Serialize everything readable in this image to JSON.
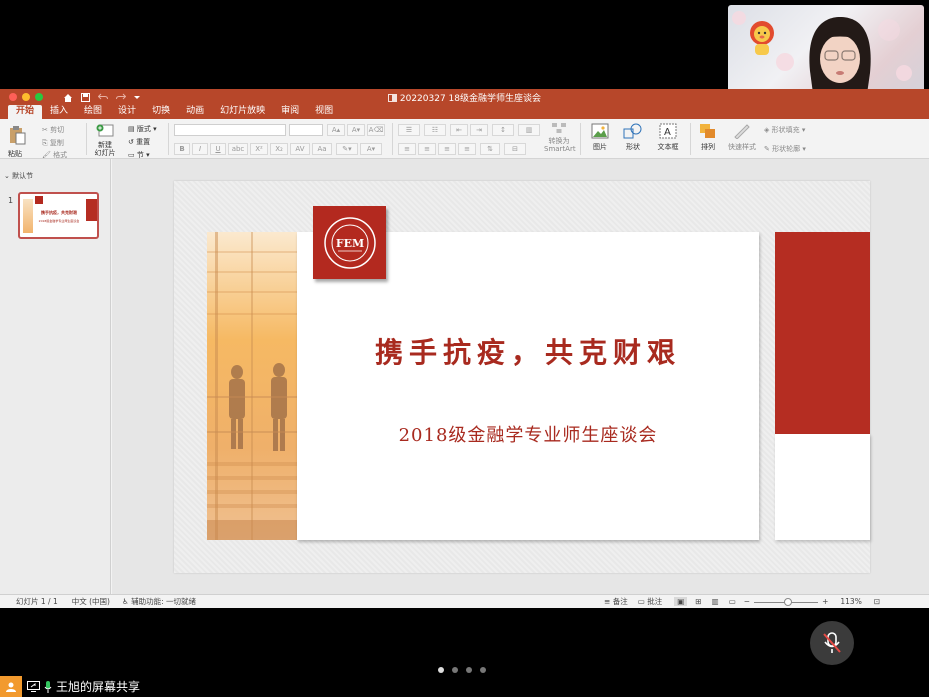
{
  "meeting": {
    "participant_name": "王旭",
    "share_label": "王旭的屏幕共享",
    "page_dots": 4,
    "active_page": 0
  },
  "ppt": {
    "doc_title": "20220327 18级金融学师生座谈会",
    "tabs": [
      "开始",
      "插入",
      "绘图",
      "设计",
      "切换",
      "动画",
      "幻灯片放映",
      "审阅",
      "视图"
    ],
    "active_tab": 0,
    "ribbon": {
      "paste": "粘贴",
      "cut": "剪切",
      "copy": "复制",
      "format": "格式",
      "new_slide": "新建\n幻灯片",
      "layout": "版式",
      "reset": "重置",
      "section": "节",
      "convert_smartart": "转换为\nSmartArt",
      "picture": "图片",
      "shape": "形状",
      "textbox": "文本框",
      "arrange": "排列",
      "quick_styles": "快速样式",
      "shape_fill": "形状填充",
      "shape_outline": "形状轮廓"
    },
    "thumbs": {
      "section_label": "默认节",
      "slide_number": "1",
      "thumb_title": "携手抗疫，共克财艰",
      "thumb_subtitle": "2018级金融学专业师生座谈会"
    },
    "slide": {
      "title": "携手抗疫，共克财艰",
      "subtitle": "2018级金融学专业师生座谈会",
      "logo_text": "FEM",
      "colors": {
        "accent": "#b52d22",
        "title": "#a82a1f"
      }
    },
    "status": {
      "slide_pos": "幻灯片 1 / 1",
      "language": "中文 (中国)",
      "accessibility": "辅助功能: 一切就绪",
      "notes": "备注",
      "comments": "批注",
      "zoom": "113%"
    }
  }
}
